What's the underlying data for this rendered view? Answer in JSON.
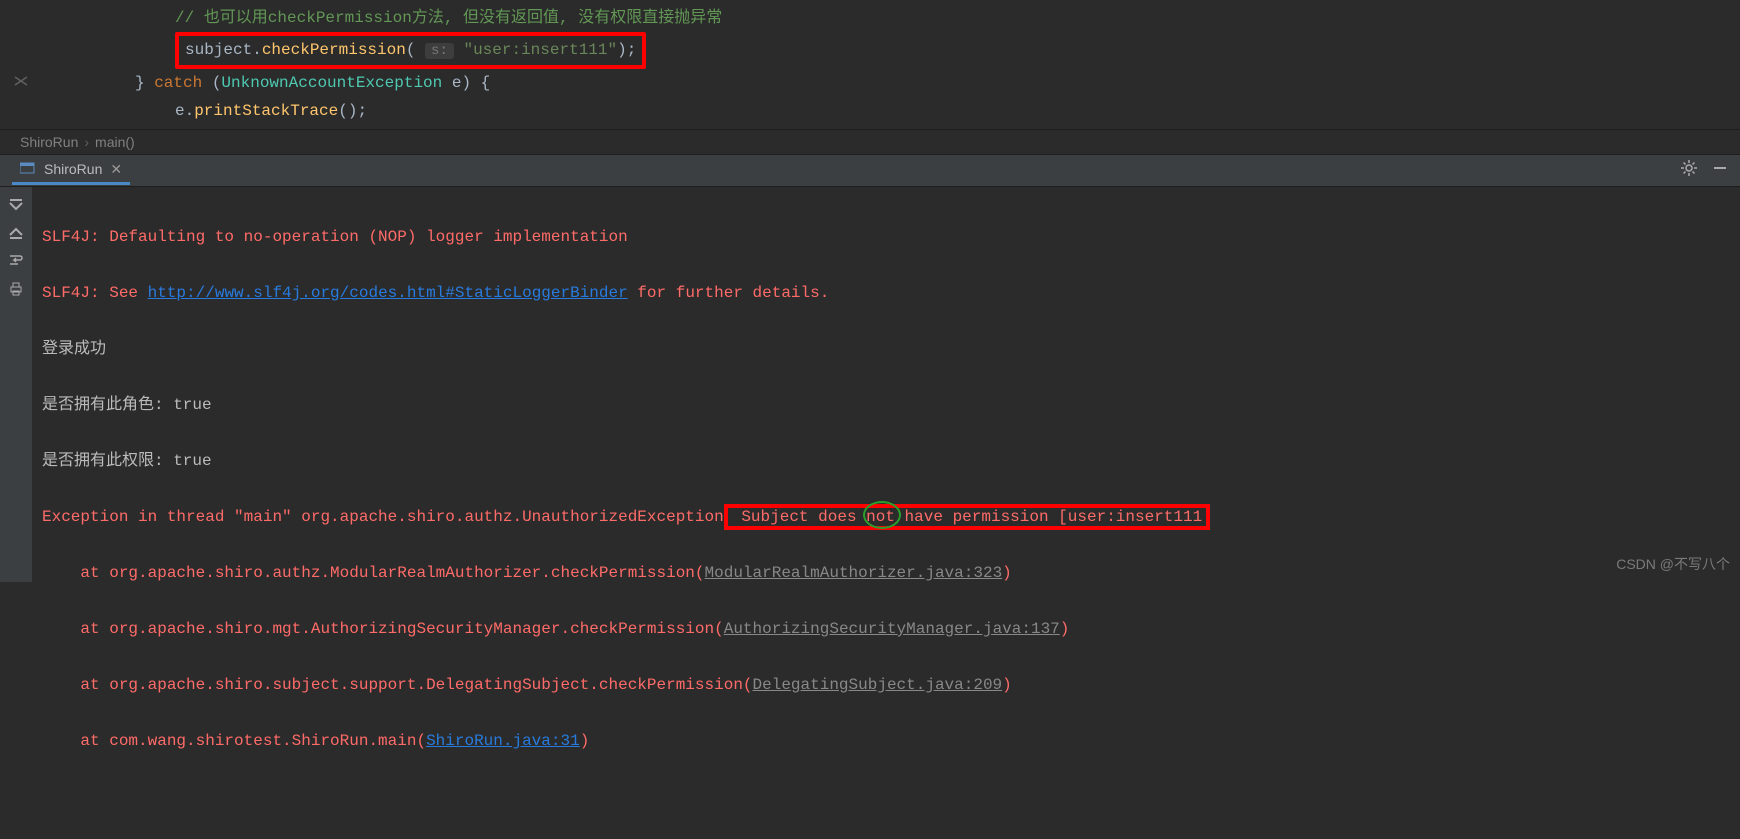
{
  "code": {
    "comment": "// 也可以用checkPermission方法, 但没有返回值, 没有权限直接抛异常",
    "subject": "subject.",
    "checkPermission": "checkPermission",
    "hint_s": "s:",
    "string_val": "\"user:insert111\"",
    "close_paren": ");",
    "catch_brace": "} ",
    "catch_kw": "catch",
    "catch_paren_open": " (",
    "exception_type": "UnknownAccountException",
    "catch_var": " e) {",
    "print_receiver": "e.",
    "print_method": "printStackTrace",
    "print_paren": "();"
  },
  "breadcrumb": {
    "class": "ShiroRun",
    "method": "main()"
  },
  "tab": {
    "label": "ShiroRun"
  },
  "console": {
    "line1_a": "SLF4J: Defaulting to no-operation (NOP) logger implementation",
    "line2_a": "SLF4J: See ",
    "line2_link": "http://www.slf4j.org/codes.html#StaticLoggerBinder",
    "line2_b": " for further details.",
    "line3": "登录成功",
    "line4": "是否拥有此角色: true",
    "line5": "是否拥有此权限: true",
    "line6_a": "Exception in thread \"main\" org.apache.shiro.authz.UnauthorizedException",
    "line6_b_1": " Subject does ",
    "line6_not": "not",
    "line6_b_2": " have permission [user:insert111",
    "line7_a": "    at org.apache.shiro.authz.ModularRealmAuthorizer.checkPermission(",
    "line7_link": "ModularRealmAuthorizer.java:323",
    "line7_b": ")",
    "line8_a": "    at org.apache.shiro.mgt.AuthorizingSecurityManager.checkPermission(",
    "line8_link": "AuthorizingSecurityManager.java:137",
    "line8_b": ")",
    "line9_a": "    at org.apache.shiro.subject.support.DelegatingSubject.checkPermission(",
    "line9_link": "DelegatingSubject.java:209",
    "line9_b": ")",
    "line10_a": "    at com.wang.shirotest.ShiroRun.main(",
    "line10_link": "ShiroRun.java:31",
    "line10_b": ")"
  },
  "watermark": "CSDN @不写八个"
}
